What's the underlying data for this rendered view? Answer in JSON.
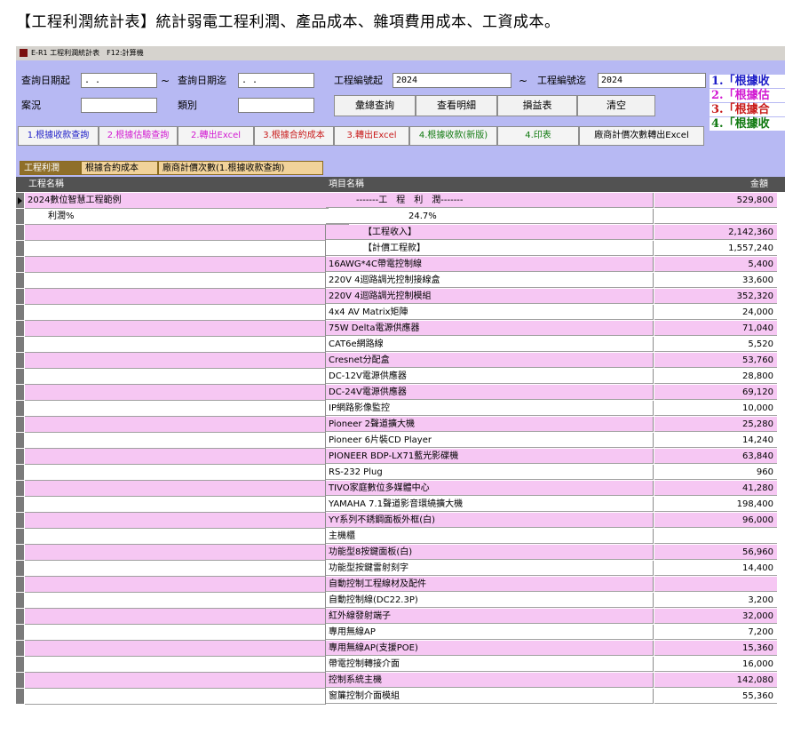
{
  "caption": "【工程利潤統計表】統計弱電工程利潤、產品成本、雜項費用成本、工資成本。",
  "window": {
    "title": "E-R1 工程利潤統計表　F12:計算機"
  },
  "filters": {
    "date_from_label": "查詢日期起",
    "date_from_value": " . .",
    "tilde": "~",
    "date_to_label": "查詢日期迄",
    "date_to_value": " . .",
    "proj_from_label": "工程編號起",
    "proj_from_value": "2024",
    "proj_to_label": "工程編號迄",
    "proj_to_value": "2024",
    "status_label": "案況",
    "status_value": "",
    "category_label": "類別",
    "category_value": ""
  },
  "buttons": {
    "summary_query": "彙總查詢",
    "detail_query": "查看明細",
    "pnl": "損益表",
    "clear": "清空"
  },
  "actions": [
    {
      "label": "1.根據收款查詢",
      "color": "#1d1dc8"
    },
    {
      "label": "2.根據估驗查詢",
      "color": "#d21ad2"
    },
    {
      "label": "2.轉出Excel",
      "color": "#d21ad2"
    },
    {
      "label": "3.根據合約成本",
      "color": "#c81a1a"
    },
    {
      "label": "3.轉出Excel",
      "color": "#c81a1a"
    },
    {
      "label": "4.根據收款(新版)",
      "color": "#117a11"
    },
    {
      "label": "4.印表",
      "color": "#117a11"
    },
    {
      "label": "廠商計價次數轉出Excel",
      "color": "#000000"
    }
  ],
  "notes": [
    {
      "label": "1.「根據收",
      "color": "#1d1dc8"
    },
    {
      "label": "2.「根據估",
      "color": "#d21ad2"
    },
    {
      "label": "3.「根據合",
      "color": "#c81a1a"
    },
    {
      "label": "4.「根據收",
      "color": "#117a11"
    }
  ],
  "tabs": [
    "工程利潤",
    "根據合約成本",
    "廠商計價次數(1.根據收款查詢)"
  ],
  "grid": {
    "columns": [
      "工程名稱",
      "項目名稱",
      "金額"
    ],
    "rows": [
      {
        "c1": "2024數位智慧工程範例",
        "c2": "-------工　程　利　潤-------",
        "c3": "529,800",
        "bg": "pink",
        "c2pad": 34,
        "c1pad": 3,
        "current": true
      },
      {
        "c1": "利潤%",
        "c2": "24.7%",
        "c3": "",
        "bg": "white",
        "c2pad": 93,
        "c1pad": 26
      },
      {
        "c1": "",
        "c2": "【工程收入】",
        "c3": "2,142,360",
        "bg": "pink",
        "c2pad": 42
      },
      {
        "c1": "",
        "c2": "【計價工程款】",
        "c3": "1,557,240",
        "bg": "white",
        "c2pad": 42
      },
      {
        "c1": "",
        "c2": "16AWG*4C帶電控制線",
        "c3": "5,400",
        "bg": "pink"
      },
      {
        "c1": "",
        "c2": "220V 4迴路調光控制接線盒",
        "c3": "33,600",
        "bg": "white"
      },
      {
        "c1": "",
        "c2": "220V 4迴路調光控制模組",
        "c3": "352,320",
        "bg": "pink"
      },
      {
        "c1": "",
        "c2": "4x4 AV Matrix矩陣",
        "c3": "24,000",
        "bg": "white"
      },
      {
        "c1": "",
        "c2": "75W Delta電源供應器",
        "c3": "71,040",
        "bg": "pink"
      },
      {
        "c1": "",
        "c2": "CAT6e網路線",
        "c3": "5,520",
        "bg": "white"
      },
      {
        "c1": "",
        "c2": "Cresnet分配盒",
        "c3": "53,760",
        "bg": "pink"
      },
      {
        "c1": "",
        "c2": "DC-12V電源供應器",
        "c3": "28,800",
        "bg": "white"
      },
      {
        "c1": "",
        "c2": "DC-24V電源供應器",
        "c3": "69,120",
        "bg": "pink"
      },
      {
        "c1": "",
        "c2": "IP網路影像監控",
        "c3": "10,000",
        "bg": "white"
      },
      {
        "c1": "",
        "c2": "Pioneer 2聲道擴大機",
        "c3": "25,280",
        "bg": "pink"
      },
      {
        "c1": "",
        "c2": "Pioneer 6片裝CD Player",
        "c3": "14,240",
        "bg": "white"
      },
      {
        "c1": "",
        "c2": "PIONEER BDP-LX71藍光影碟機",
        "c3": "63,840",
        "bg": "pink"
      },
      {
        "c1": "",
        "c2": "RS-232 Plug",
        "c3": "960",
        "bg": "white"
      },
      {
        "c1": "",
        "c2": "TIVO家庭數位多媒體中心",
        "c3": "41,280",
        "bg": "pink"
      },
      {
        "c1": "",
        "c2": "YAMAHA 7.1聲道影音環繞擴大機",
        "c3": "198,400",
        "bg": "white"
      },
      {
        "c1": "",
        "c2": "YY系列不銹鋼面板外框(白)",
        "c3": "96,000",
        "bg": "pink"
      },
      {
        "c1": "",
        "c2": "主機櫃",
        "c3": "",
        "bg": "white"
      },
      {
        "c1": "",
        "c2": "功能型8按鍵面板(白)",
        "c3": "56,960",
        "bg": "pink"
      },
      {
        "c1": "",
        "c2": "功能型按鍵雷射刻字",
        "c3": "14,400",
        "bg": "white"
      },
      {
        "c1": "",
        "c2": "自動控制工程線材及配件",
        "c3": "",
        "bg": "pink"
      },
      {
        "c1": "",
        "c2": "自動控制線(DC22.3P)",
        "c3": "3,200",
        "bg": "white"
      },
      {
        "c1": "",
        "c2": "紅外線發射端子",
        "c3": "32,000",
        "bg": "pink"
      },
      {
        "c1": "",
        "c2": "專用無線AP",
        "c3": "7,200",
        "bg": "white"
      },
      {
        "c1": "",
        "c2": "專用無線AP(支援POE)",
        "c3": "15,360",
        "bg": "pink"
      },
      {
        "c1": "",
        "c2": "帶電控制轉接介面",
        "c3": "16,000",
        "bg": "white"
      },
      {
        "c1": "",
        "c2": "控制系統主機",
        "c3": "142,080",
        "bg": "pink"
      },
      {
        "c1": "",
        "c2": "窗簾控制介面模組",
        "c3": "55,360",
        "bg": "white"
      }
    ]
  }
}
